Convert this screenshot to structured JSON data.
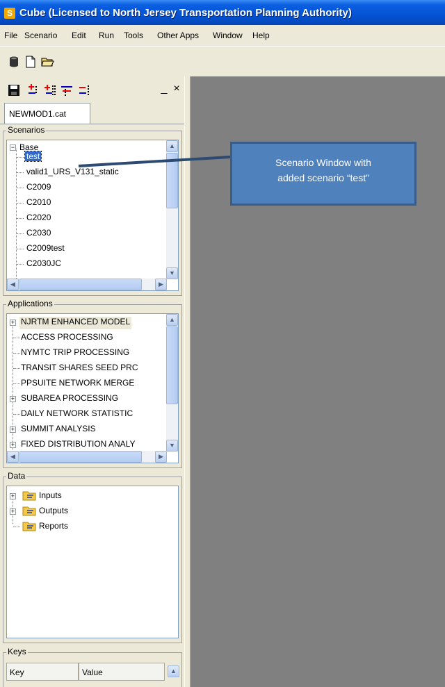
{
  "window": {
    "title": "Cube (Licensed to North Jersey Transportation Planning Authority)",
    "icon": "cube-app-icon"
  },
  "menu": [
    "File",
    "Scenario",
    "Edit",
    "Run",
    "Tools",
    "Other Apps",
    "Window",
    "Help"
  ],
  "toolbar": {
    "icons": [
      "database-icon",
      "new-file-icon",
      "open-folder-icon"
    ]
  },
  "catalog": {
    "tab": "NEWMOD1.cat",
    "tool_icons": [
      "save-icon",
      "add-scenario-icon",
      "add-child-scenario-icon",
      "edit-scenario-icon",
      "delete-scenario-icon"
    ],
    "minimize": "_",
    "close": "×"
  },
  "scenarios": {
    "label": "Scenarios",
    "root": "Base",
    "items": [
      "test",
      "valid1_URS_V131_static",
      "C2009",
      "C2010",
      "C2020",
      "C2030",
      "C2009test",
      "C2030JC"
    ]
  },
  "applications": {
    "label": "Applications",
    "items": [
      {
        "label": "NJRTM ENHANCED MODEL",
        "expandable": true
      },
      {
        "label": "ACCESS PROCESSING",
        "expandable": false
      },
      {
        "label": "NYMTC TRIP PROCESSING",
        "expandable": false
      },
      {
        "label": "TRANSIT SHARES SEED PRC",
        "expandable": false
      },
      {
        "label": "PPSUITE NETWORK MERGE",
        "expandable": false
      },
      {
        "label": "SUBAREA PROCESSING",
        "expandable": true
      },
      {
        "label": "DAILY NETWORK STATISTIC",
        "expandable": false
      },
      {
        "label": "SUMMIT ANALYSIS",
        "expandable": true
      },
      {
        "label": "FIXED DISTRIBUTION ANALY",
        "expandable": true
      }
    ]
  },
  "data_panel": {
    "label": "Data",
    "items": [
      {
        "label": "Inputs",
        "expandable": true
      },
      {
        "label": "Outputs",
        "expandable": true
      },
      {
        "label": "Reports",
        "expandable": false
      }
    ]
  },
  "keys": {
    "label": "Keys",
    "col_key": "Key",
    "col_value": "Value"
  },
  "callout": {
    "line1": "Scenario Window with",
    "line2": "added scenario “test”"
  },
  "colors": {
    "title_bar": "#0553d4",
    "workspace": "#808080",
    "callout_fill": "#4f81bd",
    "selection": "#316ac5"
  }
}
